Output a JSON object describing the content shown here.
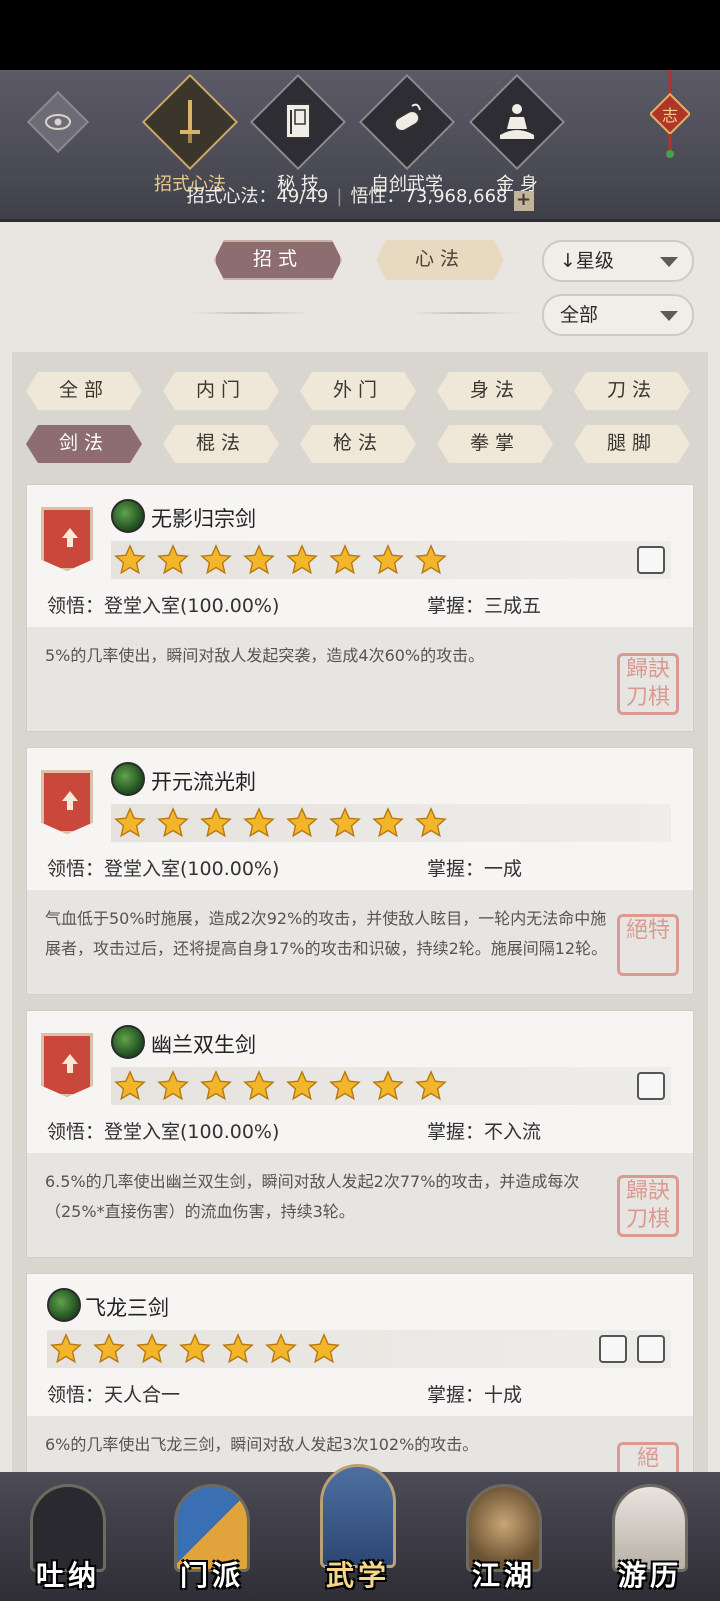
{
  "header": {
    "tabs": [
      {
        "label": "招式心法",
        "icon": "sword-icon",
        "active": true
      },
      {
        "label": "秘 技",
        "icon": "book-icon",
        "active": false
      },
      {
        "label": "自创武学",
        "icon": "scroll-icon",
        "active": false
      },
      {
        "label": "金 身",
        "icon": "meditation-icon",
        "active": false
      }
    ],
    "stats": {
      "moves_label": "招式心法：",
      "moves_value": "49/49",
      "insight_label": "悟性：",
      "insight_value": "73,968,668",
      "plus": "+"
    },
    "knot_char": "志"
  },
  "controls": {
    "seg_moves": "招式",
    "seg_methods": "心法",
    "sort_label": "星级",
    "sort_arrow": "↓",
    "filter_label": "全部"
  },
  "categories": [
    "全部",
    "内门",
    "外门",
    "身法",
    "刀法",
    "剑法",
    "棍法",
    "枪法",
    "拳掌",
    "腿脚"
  ],
  "active_category": "剑法",
  "skills": [
    {
      "name": "无影归宗剑",
      "stars": 8,
      "comprehension_label": "领悟：",
      "comprehension": "登堂入室(100.00%)",
      "mastery_label": "掌握：",
      "mastery": "三成五",
      "description": "5%的几率使出，瞬间对敌人发起突袭，造成4次60%的攻击。",
      "seal": "歸訣刀棋"
    },
    {
      "name": "开元流光刺",
      "stars": 8,
      "comprehension_label": "领悟：",
      "comprehension": "登堂入室(100.00%)",
      "mastery_label": "掌握：",
      "mastery": "一成",
      "description": "气血低于50%时施展，造成2次92%的攻击，并使敌人眩目，一轮内无法命中施展者，攻击过后，还将提高自身17%的攻击和识破，持续2轮。施展间隔12轮。",
      "seal": "絕特"
    },
    {
      "name": "幽兰双生剑",
      "stars": 8,
      "comprehension_label": "领悟：",
      "comprehension": "登堂入室(100.00%)",
      "mastery_label": "掌握：",
      "mastery": "不入流",
      "description": "6.5%的几率使出幽兰双生剑，瞬间对敌人发起2次77%的攻击，并造成每次（25%*直接伤害）的流血伤害，持续3轮。",
      "seal": "歸訣刀棋"
    },
    {
      "name": "飞龙三剑",
      "stars": 7,
      "comprehension_label": "领悟：",
      "comprehension": "天人合一",
      "mastery_label": "掌握：",
      "mastery": "十成",
      "description": "6%的几率使出飞龙三剑，瞬间对敌人发起3次102%的攻击。",
      "seal": "絕"
    }
  ],
  "bottom_nav": [
    {
      "label": "吐纳",
      "active": false
    },
    {
      "label": "门派",
      "active": false
    },
    {
      "label": "武学",
      "active": true
    },
    {
      "label": "江湖",
      "active": false
    },
    {
      "label": "游历",
      "active": false
    }
  ],
  "colors": {
    "accent_active": "#8d6d6f",
    "gold": "#e9c98a",
    "banner_red": "#c9473b",
    "star": "#f3b62b"
  }
}
